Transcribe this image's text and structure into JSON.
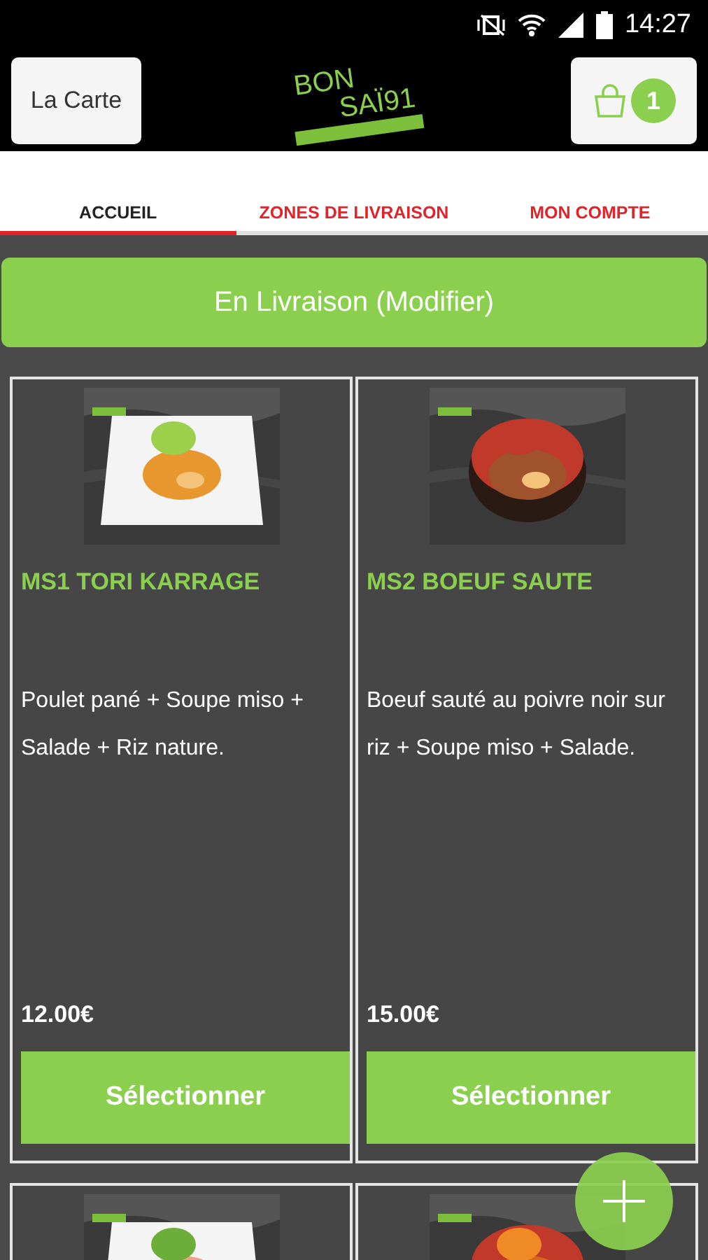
{
  "status_bar": {
    "time": "14:27"
  },
  "header": {
    "menu_button": "La Carte",
    "logo": {
      "line_1": "BON",
      "line_2": "SAÏ91"
    },
    "cart_count": "1"
  },
  "tabs": [
    {
      "label": "ACCUEIL",
      "selected": true
    },
    {
      "label": "ZONES DE LIVRAISON",
      "selected": false
    },
    {
      "label": "MON COMPTE",
      "selected": false
    }
  ],
  "delivery_banner": "En Livraison (Modifier)",
  "products": [
    {
      "image": {
        "kind": "picture"
      },
      "name": "MS1 TORI KARRAGE",
      "description": "Poulet pané + Soupe miso + Salade + Riz nature.",
      "price": "12.00€",
      "button": "Sélectionner"
    },
    {
      "image": {
        "kind": "picture"
      },
      "name": "MS2 BOEUF SAUTE",
      "description": "Boeuf sauté au poivre noir sur riz + Soupe miso + Salade.",
      "price": "15.00€",
      "button": "Sélectionner"
    },
    {
      "image": {
        "kind": "picture"
      }
    },
    {
      "image": {
        "kind": "picture"
      }
    }
  ]
}
